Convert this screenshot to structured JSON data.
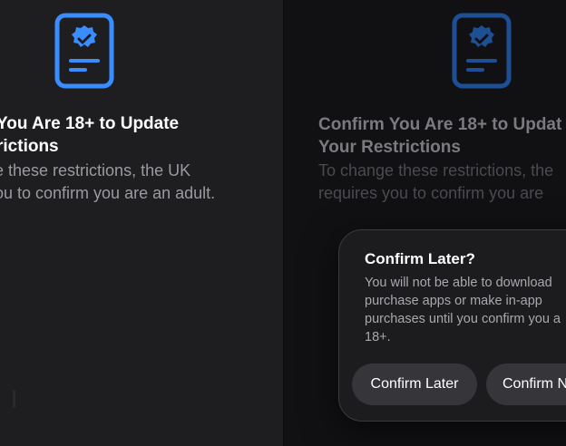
{
  "colors": {
    "icon_left": "#3a8dff",
    "icon_right": "#1d4f94",
    "background_left": "#1e1e20",
    "background_right": "#111113",
    "dialog_bg": "#1c1c1e",
    "button_bg": "#36363a"
  },
  "left": {
    "icon": "verified-document-icon",
    "title_line1": "You Are 18+ to Update",
    "title_line2": "rictions",
    "body_line1": "e these restrictions, the UK",
    "body_line2": "ou to confirm you are an adult."
  },
  "right": {
    "icon": "verified-document-icon",
    "title_line1": "Confirm You Are 18+ to Updat",
    "title_line2": "Your Restrictions",
    "body_line1": "To change these restrictions, the",
    "body_line2": "requires you to confirm you are"
  },
  "dialog": {
    "title": "Confirm Later?",
    "message_line1": "You will not be able to download",
    "message_line2": "purchase apps or make in-app",
    "message_line3": "purchases until you confirm you a",
    "message_line4": "18+.",
    "confirm_later_label": "Confirm Later",
    "confirm_now_label": "Confirm N"
  }
}
